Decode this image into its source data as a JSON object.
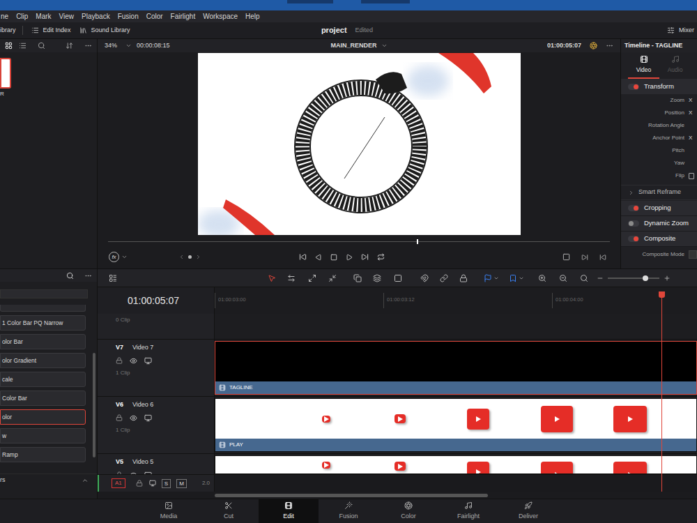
{
  "menu": [
    "ne",
    "Clip",
    "Mark",
    "View",
    "Playback",
    "Fusion",
    "Color",
    "Fairlight",
    "Workspace",
    "Help"
  ],
  "toolbar": {
    "items": [
      "ibrary",
      "Edit Index",
      "Sound Library"
    ],
    "project": "project",
    "status": "Edited",
    "mixer": "Mixer"
  },
  "media_pool": {
    "clips": [
      {
        "label": "R",
        "selected": true
      }
    ]
  },
  "viewer": {
    "zoom": "34%",
    "duration": "00:00:08:15",
    "timeline": "MAIN_RENDER",
    "timecode": "01:00:05:07",
    "fx": "fx",
    "scrub_level": 0.615
  },
  "inspector": {
    "title": "Timeline - TAGLINE",
    "tabs": [
      {
        "label": "Video",
        "selected": true
      },
      {
        "label": "Audio",
        "selected": false
      }
    ],
    "transform": {
      "label": "Transform",
      "on": true,
      "fields": [
        {
          "label": "Zoom",
          "value": "X",
          "kind": "value"
        },
        {
          "label": "Position",
          "value": "X",
          "kind": "value"
        },
        {
          "label": "Rotation Angle",
          "value": "",
          "kind": "value"
        },
        {
          "label": "Anchor Point",
          "value": "X",
          "kind": "value"
        },
        {
          "label": "Pitch",
          "value": "",
          "kind": "value"
        },
        {
          "label": "Yaw",
          "value": "",
          "kind": "value"
        },
        {
          "label": "Flip",
          "value": "",
          "kind": "flip"
        }
      ]
    },
    "sections": [
      {
        "label": "Smart Reframe",
        "kind": "collapsed",
        "on": false
      },
      {
        "label": "Cropping",
        "kind": "toggle",
        "on": true
      },
      {
        "label": "Dynamic Zoom",
        "kind": "toggle",
        "on": false
      },
      {
        "label": "Composite",
        "kind": "toggle",
        "on": true
      },
      {
        "label": "Composite Mode",
        "kind": "field",
        "on": false
      }
    ]
  },
  "effects": {
    "items": [
      {
        "label": "1 Color Bar PQ Narrow",
        "selected": false
      },
      {
        "label": "olor Bar",
        "selected": false
      },
      {
        "label": "olor Gradient",
        "selected": false
      },
      {
        "label": "cale",
        "selected": false
      },
      {
        "label": "Color Bar",
        "selected": false
      },
      {
        "label": "olor",
        "selected": true
      },
      {
        "label": "w",
        "selected": false
      },
      {
        "label": "Ramp",
        "selected": false
      }
    ],
    "group": {
      "label": "rs",
      "expanded": true
    }
  },
  "timeline": {
    "timecode": "01:00:05:07",
    "ruler": [
      "01:00:03:00",
      "01:00:03:12",
      "01:00:04:00"
    ],
    "playhead_level": 0.926,
    "tracks": [
      {
        "kind": "stub",
        "label": "",
        "name": "",
        "count": "0 Clip"
      },
      {
        "kind": "video",
        "label": "V7",
        "name": "Video 7",
        "count": "1 Clip",
        "clip": {
          "title": "TAGLINE",
          "kind": "black",
          "selected": true
        }
      },
      {
        "kind": "video",
        "label": "V6",
        "name": "Video 6",
        "count": "1 Clip",
        "clip": {
          "title": "PLAY",
          "kind": "frames",
          "selected": false
        }
      },
      {
        "kind": "partial",
        "label": "V5",
        "name": "Video 5",
        "count": "",
        "clip": {
          "title": "",
          "kind": "frames",
          "selected": false
        }
      }
    ],
    "audio": {
      "label": "A1",
      "solo": "S",
      "mute": "M",
      "format": "2.0"
    }
  },
  "pages": [
    {
      "label": "Media",
      "selected": false
    },
    {
      "label": "Cut",
      "selected": false
    },
    {
      "label": "Edit",
      "selected": true
    },
    {
      "label": "Fusion",
      "selected": false
    },
    {
      "label": "Color",
      "selected": false
    },
    {
      "label": "Fairlight",
      "selected": false
    },
    {
      "label": "Deliver",
      "selected": false
    }
  ]
}
